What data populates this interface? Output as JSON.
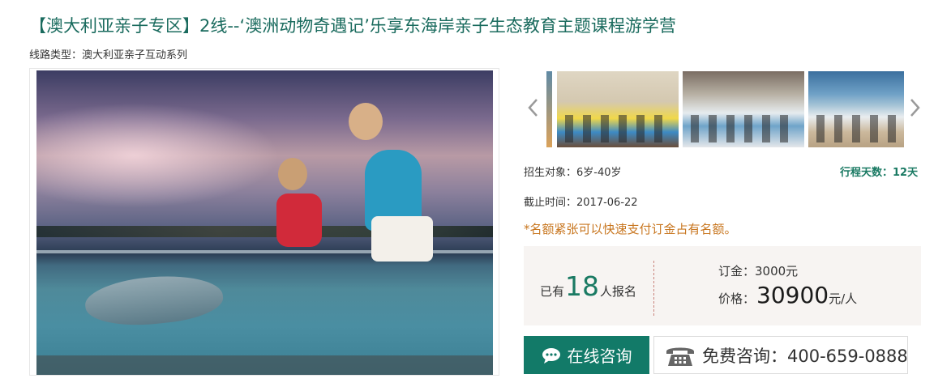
{
  "header": {
    "title": "【澳大利亚亲子专区】2线--‘澳洲动物奇遇记’乐享东海岸亲子生态教育主题课程游学营",
    "route_type": "线路类型：澳大利亚亲子互动系列"
  },
  "gallery": {
    "prev_icon": "chevron-left-icon",
    "next_icon": "chevron-right-icon"
  },
  "info": {
    "target": "招生对象：6岁-40岁",
    "days": "行程天数：12天",
    "deadline": "截止时间：2017-06-22",
    "notice": "*名额紧张可以快速支付订金占有名额。"
  },
  "pricing": {
    "signup_prefix": "已有",
    "signup_count": "18",
    "signup_suffix": "人报名",
    "deposit": "订金：3000元",
    "price_label": "价格：",
    "price_amount": "30900",
    "price_unit": "元/人"
  },
  "actions": {
    "online_label": "在线咨询",
    "phone_label": "免费咨询：400-659-0888"
  },
  "colors": {
    "brand_green": "#127a68",
    "title_green": "#1a6b5e",
    "notice_orange": "#c8761f",
    "price_bg": "#f7f4f2"
  }
}
